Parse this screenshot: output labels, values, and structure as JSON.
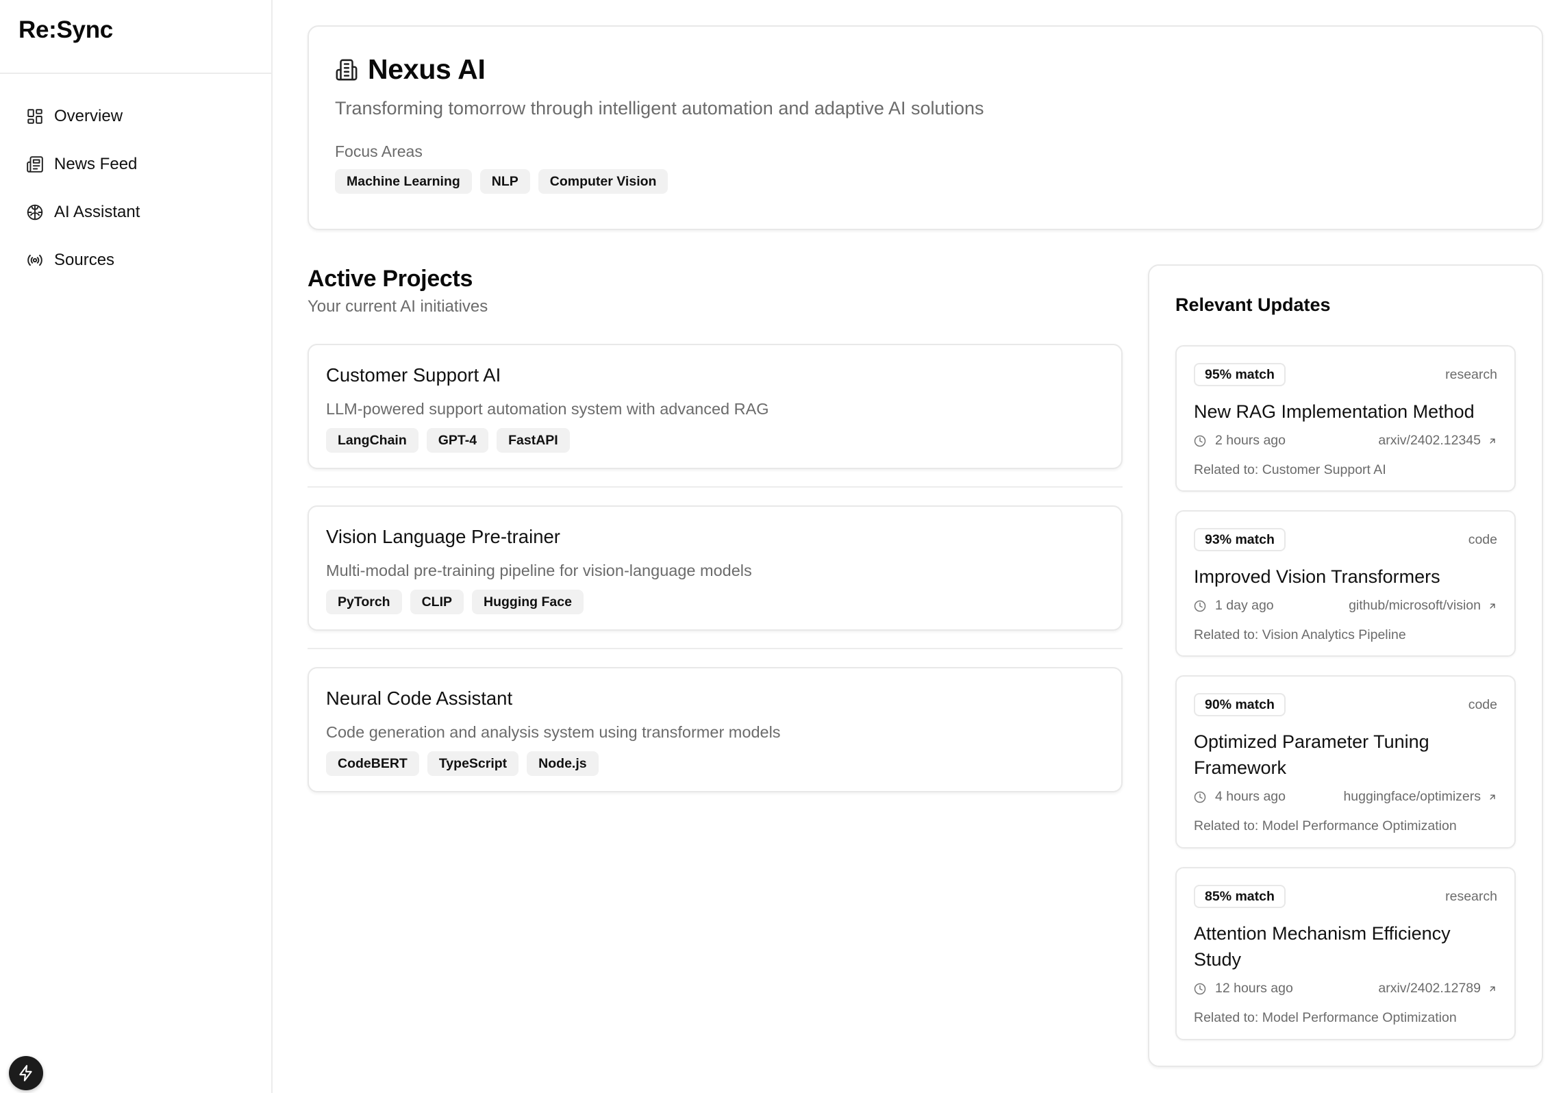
{
  "app": {
    "logo": "Re:Sync"
  },
  "sidebar": {
    "items": [
      {
        "label": "Overview",
        "icon": "layout-dashboard-icon"
      },
      {
        "label": "News Feed",
        "icon": "newspaper-icon"
      },
      {
        "label": "AI Assistant",
        "icon": "brain-icon"
      },
      {
        "label": "Sources",
        "icon": "radio-icon"
      }
    ],
    "bottom_icon": "bolt-icon"
  },
  "company": {
    "icon": "building-icon",
    "name": "Nexus AI",
    "tagline": "Transforming tomorrow through intelligent automation and adaptive AI solutions",
    "focus_label": "Focus Areas",
    "focus_areas": [
      "Machine Learning",
      "NLP",
      "Computer Vision"
    ]
  },
  "projects": {
    "title": "Active Projects",
    "subtitle": "Your current AI initiatives",
    "items": [
      {
        "name": "Customer Support AI",
        "description": "LLM-powered support automation system with advanced RAG",
        "tags": [
          "LangChain",
          "GPT-4",
          "FastAPI"
        ]
      },
      {
        "name": "Vision Language Pre-trainer",
        "description": "Multi-modal pre-training pipeline for vision-language models",
        "tags": [
          "PyTorch",
          "CLIP",
          "Hugging Face"
        ]
      },
      {
        "name": "Neural Code Assistant",
        "description": "Code generation and analysis system using transformer models",
        "tags": [
          "CodeBERT",
          "TypeScript",
          "Node.js"
        ]
      }
    ]
  },
  "updates": {
    "title": "Relevant Updates",
    "items": [
      {
        "match": "95% match",
        "type": "research",
        "title": "New RAG Implementation Method",
        "time": "2 hours ago",
        "source": "arxiv/2402.12345",
        "related": "Related to: Customer Support AI"
      },
      {
        "match": "93% match",
        "type": "code",
        "title": "Improved Vision Transformers",
        "time": "1 day ago",
        "source": "github/microsoft/vision",
        "related": "Related to: Vision Analytics Pipeline"
      },
      {
        "match": "90% match",
        "type": "code",
        "title": "Optimized Parameter Tuning Framework",
        "time": "4 hours ago",
        "source": "huggingface/optimizers",
        "related": "Related to: Model Performance Optimization"
      },
      {
        "match": "85% match",
        "type": "research",
        "title": "Attention Mechanism Efficiency Study",
        "time": "12 hours ago",
        "source": "arxiv/2402.12789",
        "related": "Related to: Model Performance Optimization"
      }
    ]
  }
}
